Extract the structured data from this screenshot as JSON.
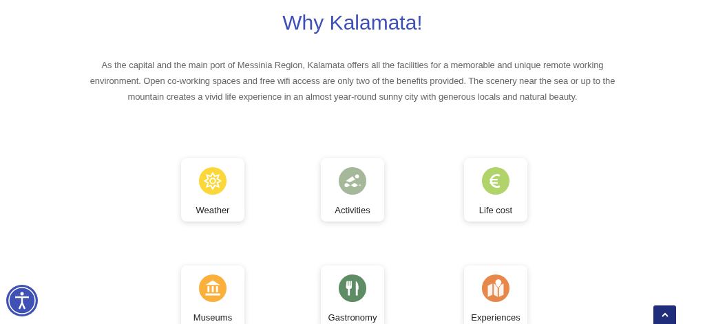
{
  "title": "Why Kalamata!",
  "intro": "As the capital and the main port of Messinia Region, Kalamata offers all the facilities for a memorable and unique remote working environment. Open co-working spaces and free wifi access are only two of the benefits provided. The scenery near the sea or up to the mountain creates a vivid life experience in an almost year-round sunny city with generous locals and natural beauty.",
  "features": [
    {
      "label": "Weather",
      "kind": "sun",
      "color": "#fcd73a"
    },
    {
      "label": "Activities",
      "kind": "swim",
      "color": "#a5b99a"
    },
    {
      "label": "Life cost",
      "kind": "euro",
      "color": "#b0d46a"
    },
    {
      "label": "Museums",
      "kind": "museum",
      "color": "#fbb03b"
    },
    {
      "label": "Gastronomy",
      "kind": "food",
      "color": "#5e8c64"
    },
    {
      "label": "Experiences",
      "kind": "map",
      "color": "#e8874a"
    }
  ]
}
